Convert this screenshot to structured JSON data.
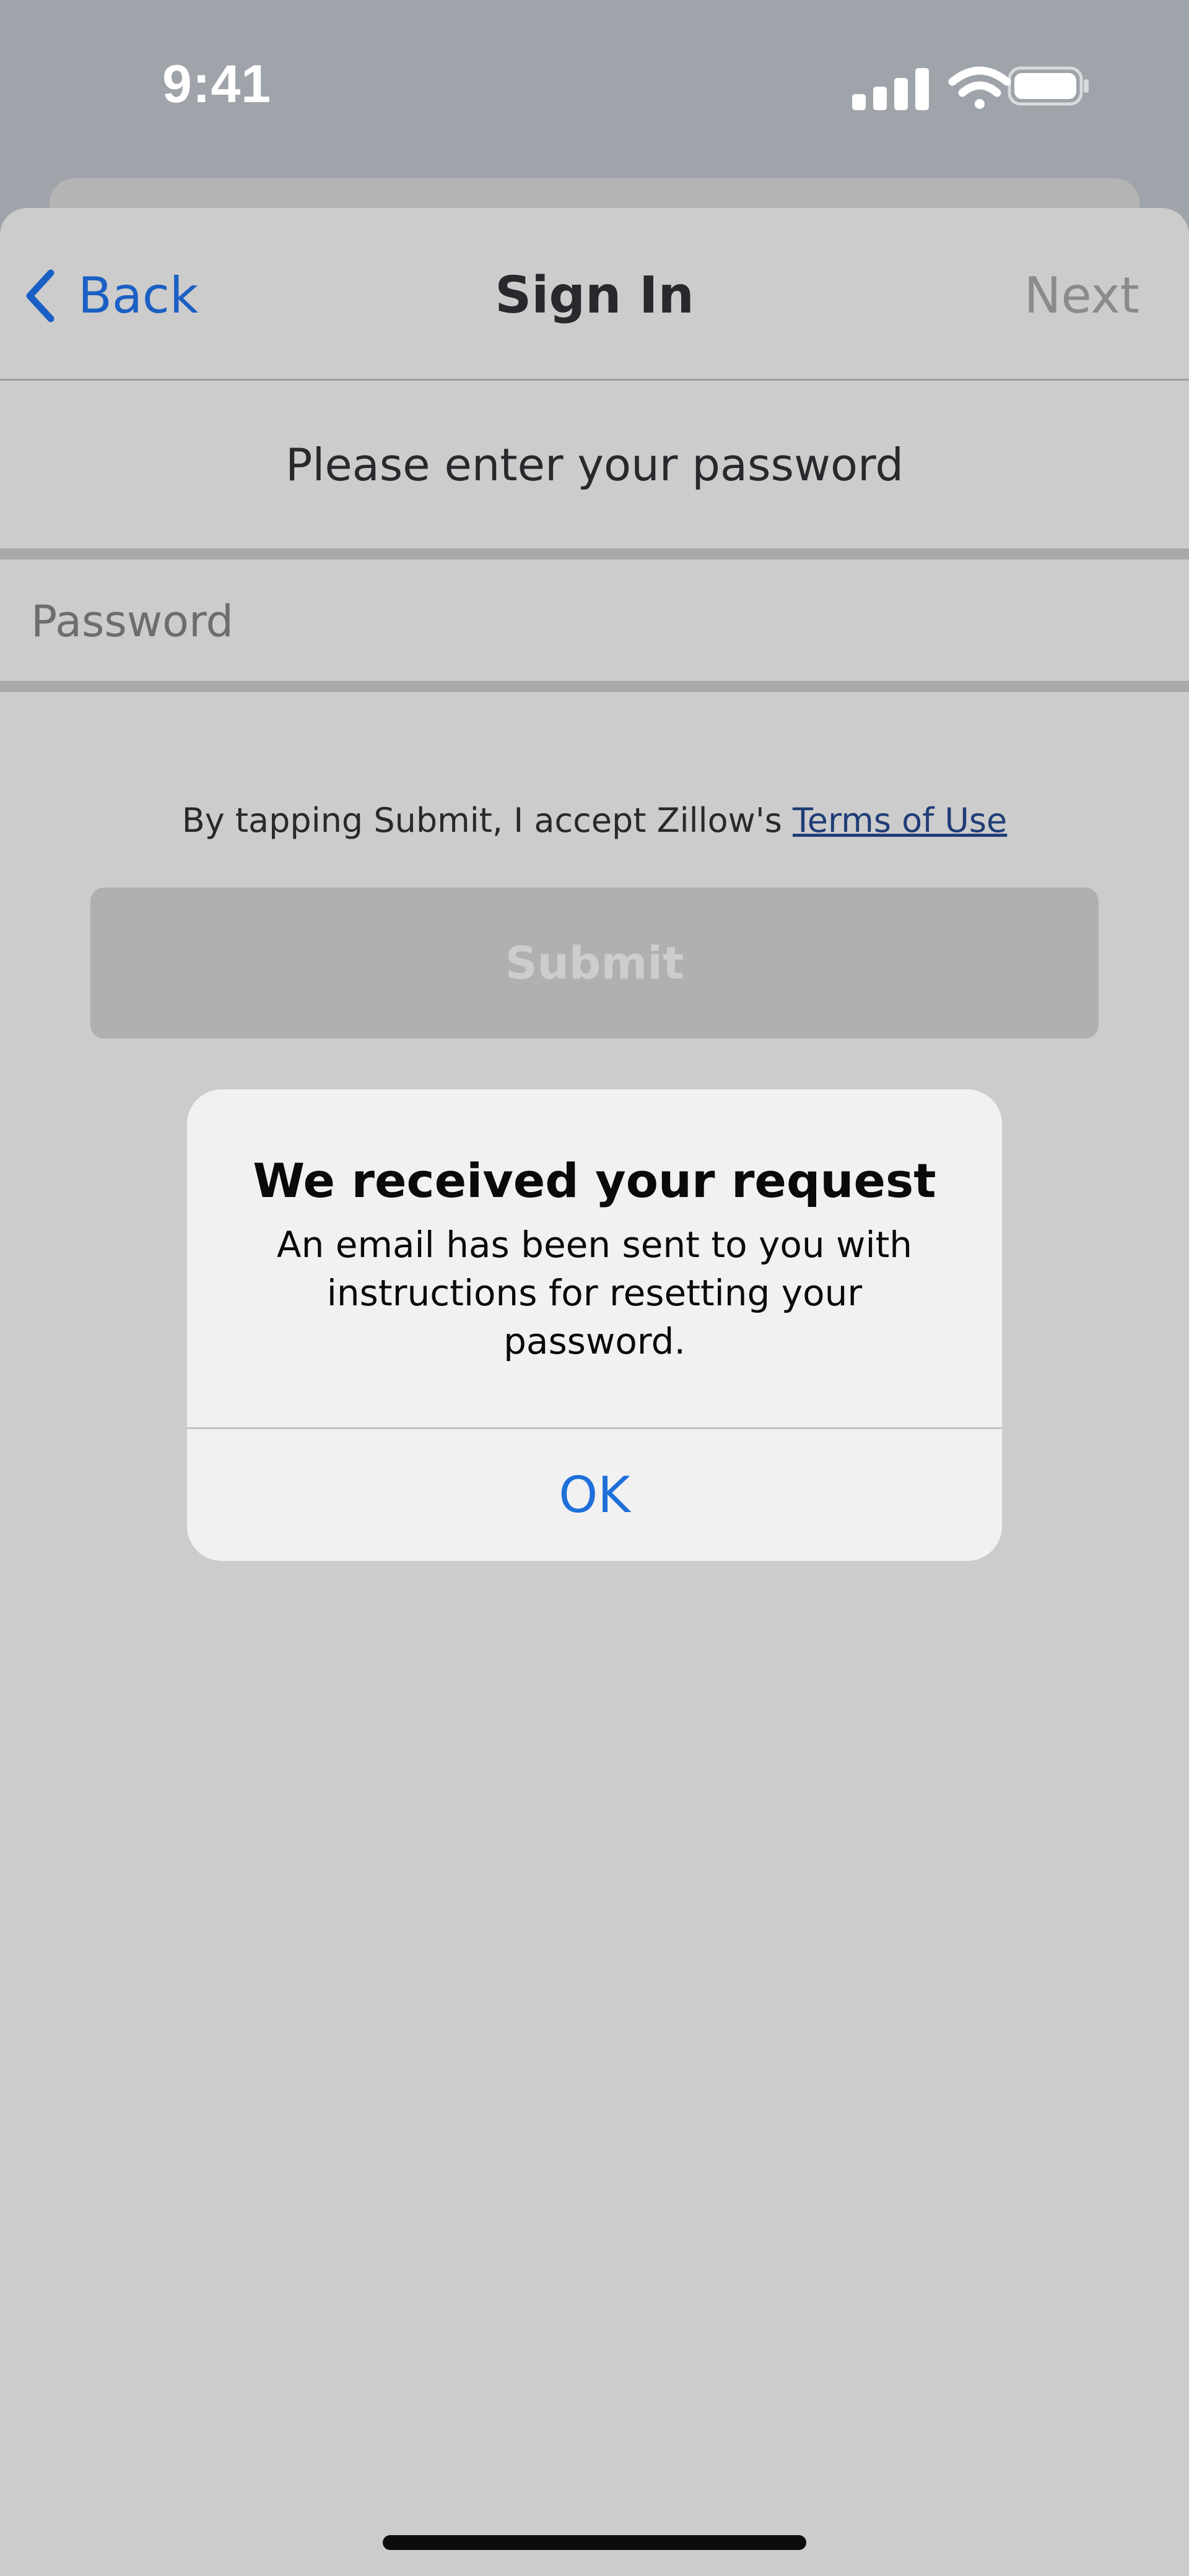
{
  "status_bar": {
    "time": "9:41",
    "icons": [
      "cellular-signal-icon",
      "wifi-icon",
      "battery-icon"
    ]
  },
  "nav": {
    "back_label": "Back",
    "title": "Sign In",
    "next_label": "Next"
  },
  "form": {
    "prompt": "Please enter your password",
    "password": {
      "value": "",
      "placeholder": "Password"
    },
    "terms_prefix": "By tapping Submit, I accept Zillow's ",
    "terms_link": "Terms of Use",
    "submit_label": "Submit"
  },
  "alert": {
    "title": "We received your request",
    "message": "An email has been sent to you with instructions for resetting your password.",
    "ok_label": "OK"
  },
  "colors": {
    "accent_blue": "#1a5fc4",
    "alert_button_blue": "#1e6fd9",
    "link_navy": "#1f3d77",
    "sheet_background": "#cccccc",
    "disabled_button": "#b0b0b0"
  }
}
